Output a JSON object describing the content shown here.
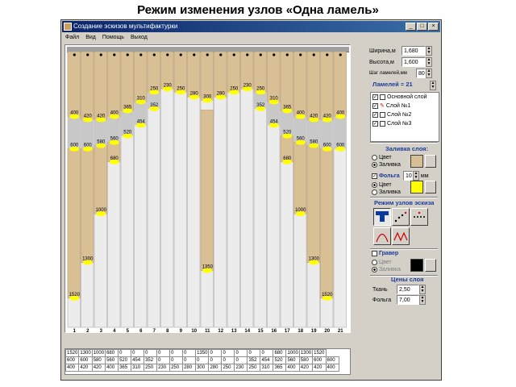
{
  "slide_title": "Режим изменения узлов «Одна ламель»",
  "window": {
    "title": "Создание эскизов мультифактурки",
    "menu": [
      "Файл",
      "Вид",
      "Помощь",
      "Выход"
    ],
    "buttons": [
      "_",
      "□",
      "×"
    ]
  },
  "params": {
    "width_label": "Ширина,м",
    "width_value": "1,680",
    "height_label": "Высота,м",
    "height_value": "1,600",
    "step_label": "Шаг ламелей,мм",
    "step_value": "80",
    "lamels_label": "Ламелей = 21"
  },
  "layers": [
    {
      "label": "Основной слой",
      "checked": true
    },
    {
      "label": "Слой №1",
      "checked": true
    },
    {
      "label": "Слой №2",
      "checked": true
    },
    {
      "label": "Слой №3",
      "checked": true
    }
  ],
  "fill_section": {
    "title": "Заливка слоя:",
    "opt_color": "Цвет",
    "opt_fill": "Заливка",
    "foil_label": "Фольга",
    "foil_value": "10",
    "foil_unit": "мм",
    "foil_color": "#ffff00"
  },
  "mode_section": {
    "title": "Режим узлов эскиза"
  },
  "engrave": {
    "label": "Гравер",
    "opt_color": "Цвет",
    "opt_fill": "Заливка",
    "swatch_color": "#000000"
  },
  "prices": {
    "title": "Цены слоя",
    "fabric_label": "Ткань",
    "fabric_value": "2,50",
    "foil_label": "Фольга",
    "foil_value": "7,00"
  },
  "colors": {
    "accent": "#1a3c9a",
    "fabric": "#d8bf94",
    "band": "#c8c8c8",
    "node_yellow": "#ffff00"
  },
  "canvas": {
    "numbers": [
      "1",
      "2",
      "3",
      "4",
      "5",
      "6",
      "7",
      "8",
      "9",
      "10",
      "11",
      "12",
      "13",
      "14",
      "15",
      "16",
      "17",
      "18",
      "19",
      "20",
      "21"
    ],
    "top_row": [
      "1520",
      "1300",
      "1000",
      "680",
      "0",
      "0",
      "0",
      "0",
      "0",
      "0",
      "1350",
      "0",
      "0",
      "0",
      "0",
      "0",
      "680",
      "1000",
      "1300",
      "1520"
    ],
    "mid_row": [
      "600",
      "600",
      "580",
      "560",
      "520",
      "454",
      "352",
      "0",
      "0",
      "0",
      "0",
      "0",
      "0",
      "0",
      "352",
      "454",
      "520",
      "560",
      "580",
      "600",
      "600"
    ],
    "bottom_row": [
      "400",
      "420",
      "420",
      "400",
      "365",
      "310",
      "250",
      "230",
      "250",
      "280",
      "300",
      "280",
      "250",
      "230",
      "250",
      "310",
      "365",
      "400",
      "420",
      "420",
      "400"
    ],
    "labels_upper": [
      "400",
      "420",
      "420",
      "400",
      "365",
      "310",
      "250",
      "230",
      "250",
      "280",
      "300",
      "280",
      "250",
      "230",
      "250",
      "310",
      "365",
      "400",
      "420",
      "420",
      "400"
    ],
    "labels_lower": [
      "600",
      "600",
      "580",
      "560",
      "520",
      "454",
      "352",
      "",
      "",
      "",
      "",
      "",
      "",
      "",
      "352",
      "454",
      "520",
      "560",
      "580",
      "600",
      "600"
    ],
    "labels_drop": [
      "1520",
      "1300",
      "1000",
      "680",
      "",
      "",
      "",
      "",
      "",
      "",
      "1350",
      "",
      "",
      "",
      "",
      "",
      "680",
      "1000",
      "1300",
      "1520",
      ""
    ]
  }
}
